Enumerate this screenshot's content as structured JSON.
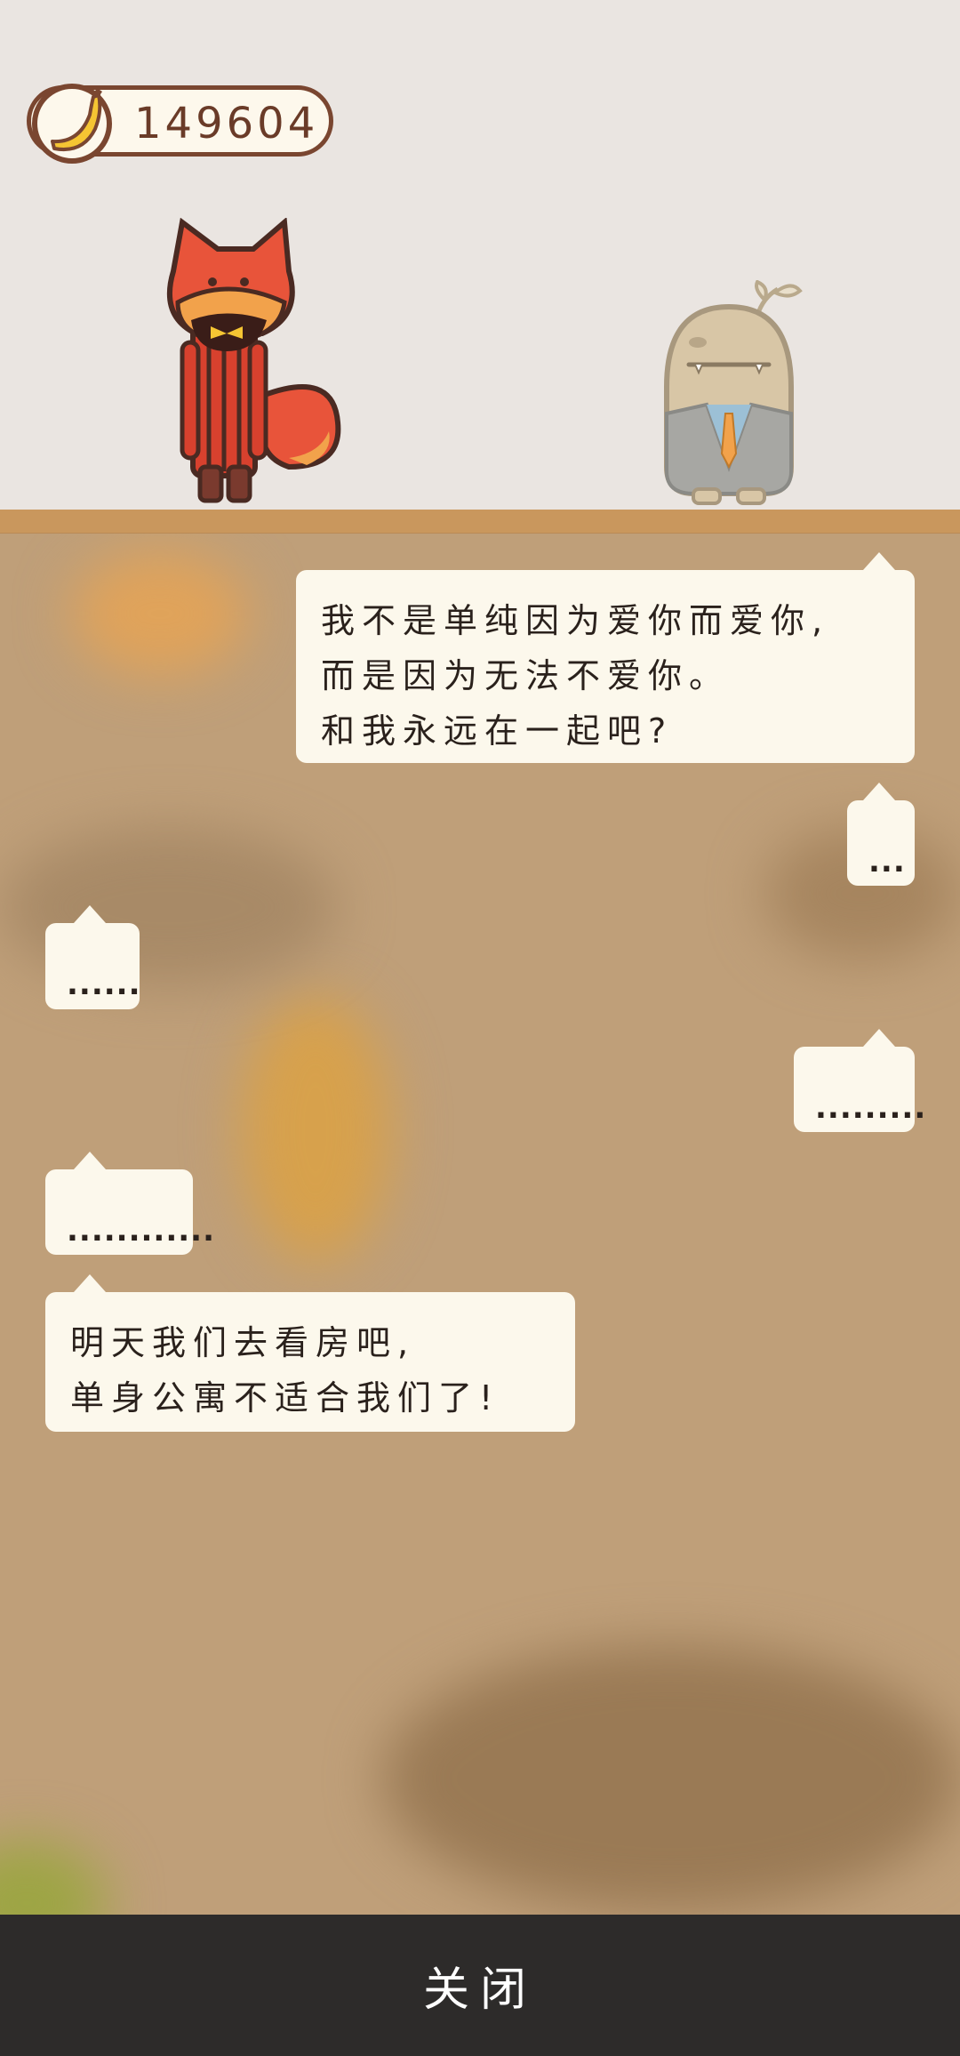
{
  "hud": {
    "coin_icon": "banana-icon",
    "coin_count": "149604"
  },
  "characters": [
    {
      "name_icon": "red-fox-character-icon"
    },
    {
      "name_icon": "potato-sprout-character-icon"
    }
  ],
  "dialogue": [
    {
      "side": "right",
      "text": "我不是单纯因为爱你而爱你,\n而是因为无法不爱你。\n和我永远在一起吧?"
    },
    {
      "side": "right",
      "text": "..."
    },
    {
      "side": "left",
      "text": "......"
    },
    {
      "side": "right",
      "text": "........."
    },
    {
      "side": "left",
      "text": "............"
    },
    {
      "side": "left",
      "text": "明天我们去看房吧,\n单身公寓不适合我们了!"
    }
  ],
  "footer": {
    "close_label": "关闭"
  },
  "colors": {
    "background_top": "#eae5e1",
    "board": "#bf9f79",
    "shelf": "#c9975d",
    "bubble": "#fcf8ec",
    "footer": "#2d2b2a",
    "coin_border": "#7a4630"
  }
}
